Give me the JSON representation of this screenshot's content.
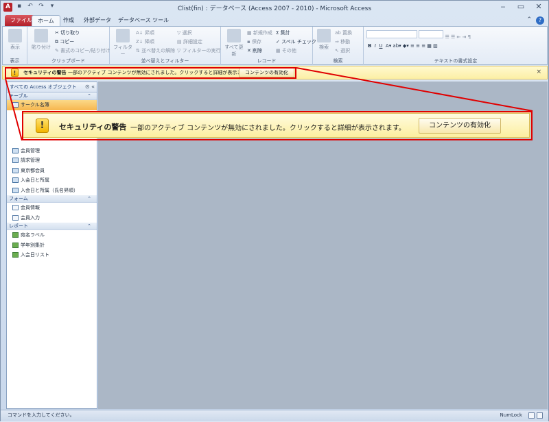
{
  "window": {
    "title": "Clist(fin) : データベース (Access 2007 - 2010) - Microsoft Access",
    "app_icon": "A",
    "qat": [
      "save-icon",
      "undo-icon",
      "redo-icon",
      "customize-icon"
    ],
    "controls": {
      "minimize": "‒",
      "restore": "▭",
      "close": "✕"
    }
  },
  "tabs": {
    "file": "ファイル",
    "home": "ホーム",
    "create": "作成",
    "external": "外部データ",
    "dbtools": "データベース ツール"
  },
  "ribbon": {
    "help": "?",
    "collapse": "⌃",
    "view_label": "表示",
    "group_view": "表示",
    "paste": "貼り付け",
    "cut": "切り取り",
    "copy": "コピー",
    "format_painter": "書式のコピー/貼り付け",
    "group_clipboard": "クリップボード",
    "filter": "フィルター",
    "ascending": "昇順",
    "descending": "降順",
    "remove_sort": "並べ替えの解除",
    "selection": "選択",
    "advanced": "詳細設定",
    "toggle_filter": "フィルターの実行",
    "group_sort": "並べ替えとフィルター",
    "refresh_all": "すべて更新",
    "new": "新規作成",
    "save": "保存",
    "delete": "削除",
    "totals": "集計",
    "spelling": "スペル チェック",
    "more": "その他",
    "group_records": "レコード",
    "find": "検索",
    "replace": "置換",
    "goto": "移動",
    "select": "選択",
    "group_find": "検索",
    "group_text": "テキストの書式設定"
  },
  "security_bar": {
    "title": "セキュリティの警告",
    "message": "一部のアクティブ コンテンツが無効にされました。クリックすると詳細が表示されます。",
    "enable_button": "コンテンツの有効化",
    "close": "×"
  },
  "nav": {
    "header": "すべての Access オブジェクト",
    "header_buttons": "⊙ «",
    "categories": [
      {
        "label": "テーブル",
        "items": [
          "サークル名簿"
        ]
      },
      {
        "label": "",
        "items": [
          "会員管理",
          "請求管理",
          "東京都会員",
          "入会日と所属",
          "入会日と所属（氏名昇順）"
        ]
      },
      {
        "label": "フォーム",
        "items": [
          "会員情報",
          "会員入力"
        ]
      },
      {
        "label": "レポート",
        "items": [
          "宛名ラベル",
          "学年別集計",
          "入会日リスト"
        ]
      }
    ]
  },
  "status": {
    "text": "コマンドを入力してください。",
    "numlock": "NumLock"
  },
  "colors": {
    "highlight": "#e00000",
    "security_bg": "#fcefa5",
    "selected": "#f6b64e"
  }
}
